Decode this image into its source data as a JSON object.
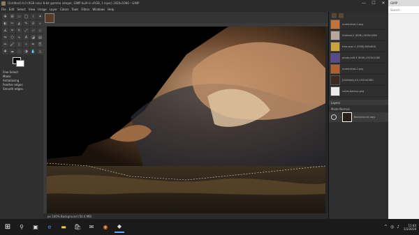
{
  "window": {
    "title": "[Untitled]-4.0 (RGB color 8-bit gamma integer, GIMP built-in sRGB, 1 layer) 1920x1080 – GIMP",
    "controls": {
      "minimize": "—",
      "maximize": "☐",
      "close": "✕"
    }
  },
  "menu": [
    "File",
    "Edit",
    "Select",
    "View",
    "Image",
    "Layer",
    "Colors",
    "Tools",
    "Filters",
    "Windows",
    "Help"
  ],
  "tool_options": {
    "title": "Free Select",
    "lines": [
      "Mode: ",
      "Antialiasing",
      "Feather edges",
      "Smooth edges"
    ]
  },
  "status": {
    "text": "px  100%  Background (50.4 MB)"
  },
  "documents": [
    {
      "name": "screenshot-1.png",
      "color": "#c2733b"
    },
    {
      "name": "Untitled-2 (RGB)-1920x1080",
      "color": "#b8a69a"
    },
    {
      "name": "tree-scan-1 (RGB)-800x600",
      "color": "#c9a23b"
    },
    {
      "name": "photo-edit 4 (RGB)-1920x1080",
      "color": "#5b4a8e"
    },
    {
      "name": "screenshot-2.png",
      "color": "#b05f2f"
    },
    {
      "name": "[Untitled]-4.0-1920x1080",
      "color": "#3d2a1d"
    },
    {
      "name": "notes-backup.png",
      "color": "#eaeaea"
    }
  ],
  "layers": {
    "header": "Layers",
    "mode": "Mode   Normal",
    "layer_name": "Background copy"
  },
  "browser": {
    "tab": "GIMP",
    "search_hint": "Search"
  },
  "taskbar": {
    "apps": [
      "start",
      "search",
      "task-view",
      "edge",
      "file-explorer",
      "store",
      "mail",
      "firefox",
      "gimp"
    ],
    "clock_time": "11:44",
    "clock_date": "1/1/2019"
  }
}
